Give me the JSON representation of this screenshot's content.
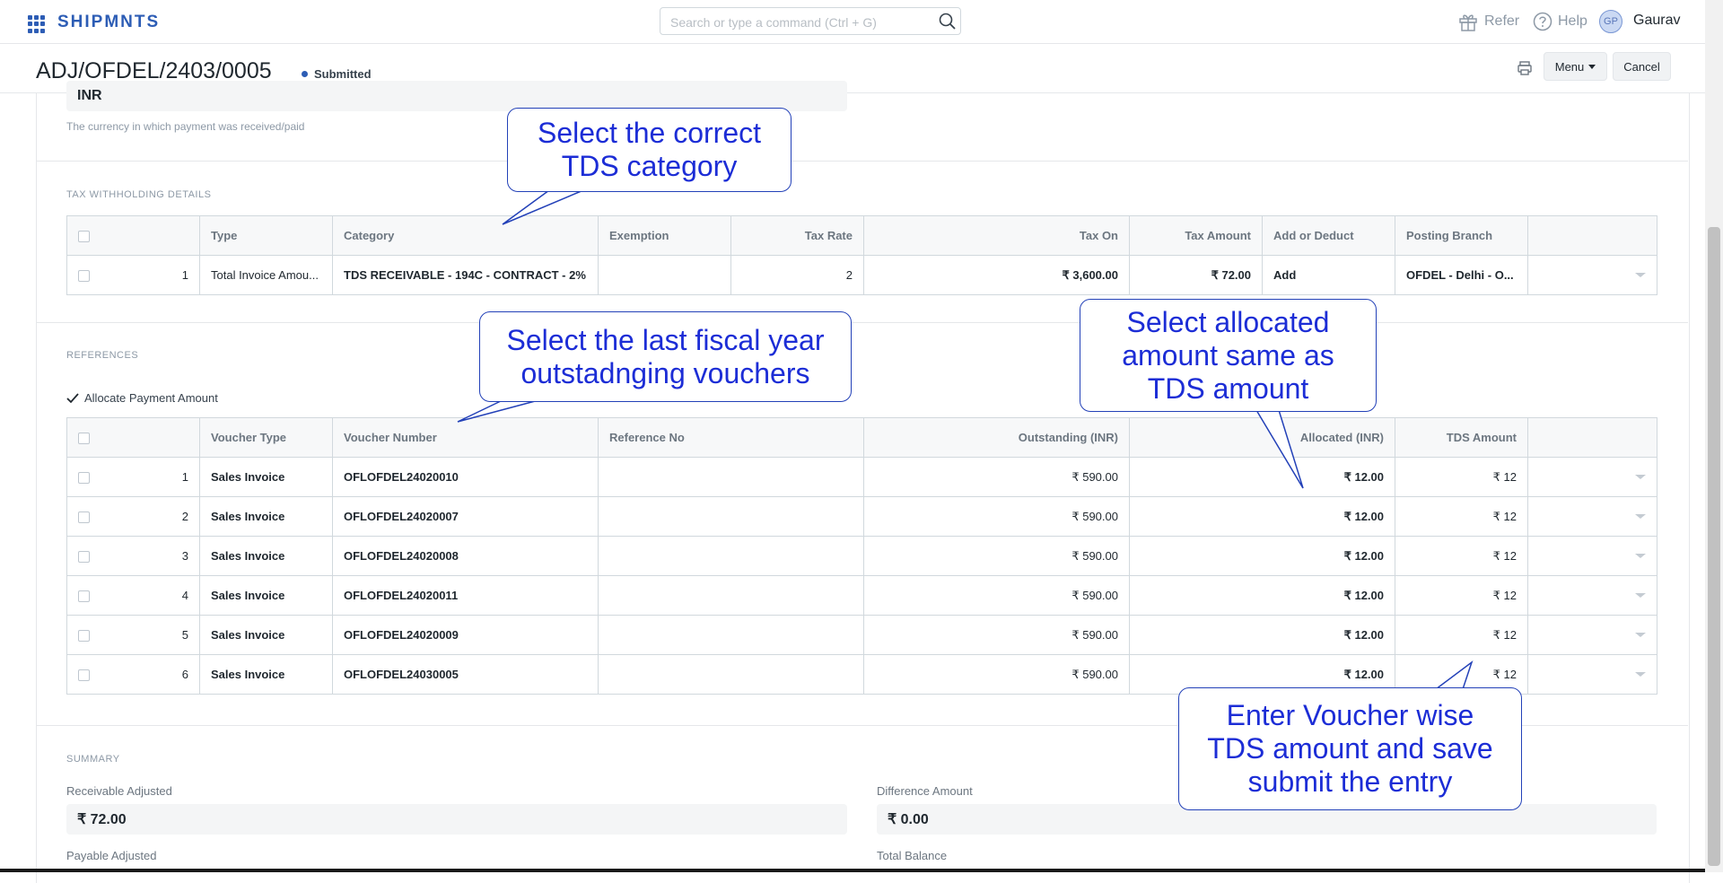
{
  "navbar": {
    "brand": "SHIPMNTS",
    "search_placeholder": "Search or type a command (Ctrl + G)",
    "refer": "Refer",
    "help": "Help",
    "avatar_initials": "GP",
    "username": "Gaurav"
  },
  "header": {
    "title": "ADJ/OFDEL/2403/0005",
    "status": "Submitted",
    "menu_label": "Menu",
    "cancel_label": "Cancel"
  },
  "currency": {
    "value": "INR",
    "help": "The currency in which payment was received/paid"
  },
  "tax_withholding": {
    "section_label": "TAX WITHHOLDING DETAILS",
    "columns": [
      "Type",
      "Category",
      "Exemption",
      "Tax Rate",
      "Tax On",
      "Tax Amount",
      "Add or Deduct",
      "Posting Branch"
    ],
    "rows": [
      {
        "idx": "1",
        "type": "Total Invoice Amou...",
        "category": "TDS RECEIVABLE - 194C - CONTRACT - 2%",
        "exemption": "",
        "tax_rate": "2",
        "tax_on": "₹ 3,600.00",
        "tax_amount": "₹ 72.00",
        "add_deduct": "Add",
        "posting_branch": "OFDEL - Delhi - O..."
      }
    ]
  },
  "references": {
    "section_label": "REFERENCES",
    "allocate_label": "Allocate Payment Amount",
    "columns": [
      "Voucher Type",
      "Voucher Number",
      "Reference No",
      "Outstanding (INR)",
      "Allocated (INR)",
      "TDS Amount"
    ],
    "rows": [
      {
        "idx": "1",
        "voucher_type": "Sales Invoice",
        "voucher_number": "OFLOFDEL24020010",
        "reference_no": "",
        "outstanding": "₹ 590.00",
        "allocated": "₹ 12.00",
        "tds": "₹ 12"
      },
      {
        "idx": "2",
        "voucher_type": "Sales Invoice",
        "voucher_number": "OFLOFDEL24020007",
        "reference_no": "",
        "outstanding": "₹ 590.00",
        "allocated": "₹ 12.00",
        "tds": "₹ 12"
      },
      {
        "idx": "3",
        "voucher_type": "Sales Invoice",
        "voucher_number": "OFLOFDEL24020008",
        "reference_no": "",
        "outstanding": "₹ 590.00",
        "allocated": "₹ 12.00",
        "tds": "₹ 12"
      },
      {
        "idx": "4",
        "voucher_type": "Sales Invoice",
        "voucher_number": "OFLOFDEL24020011",
        "reference_no": "",
        "outstanding": "₹ 590.00",
        "allocated": "₹ 12.00",
        "tds": "₹ 12"
      },
      {
        "idx": "5",
        "voucher_type": "Sales Invoice",
        "voucher_number": "OFLOFDEL24020009",
        "reference_no": "",
        "outstanding": "₹ 590.00",
        "allocated": "₹ 12.00",
        "tds": "₹ 12"
      },
      {
        "idx": "6",
        "voucher_type": "Sales Invoice",
        "voucher_number": "OFLOFDEL24030005",
        "reference_no": "",
        "outstanding": "₹ 590.00",
        "allocated": "₹ 12.00",
        "tds": "₹ 12"
      }
    ]
  },
  "summary": {
    "section_label": "SUMMARY",
    "receivable_label": "Receivable Adjusted",
    "receivable_value": "₹ 72.00",
    "difference_label": "Difference Amount",
    "difference_value": "₹ 0.00",
    "payable_label": "Payable Adjusted",
    "total_balance_label": "Total Balance"
  },
  "callouts": {
    "tds_category": [
      "Select the correct",
      "TDS category"
    ],
    "fiscal_year": [
      "Select the last fiscal year",
      "outstadnging vouchers"
    ],
    "allocated": [
      "Select allocated",
      "amount same as",
      "TDS amount"
    ],
    "voucher_tds": [
      "Enter Voucher wise",
      "TDS amount and save",
      "submit the entry"
    ]
  },
  "colors": {
    "brand": "#2d5db5",
    "callout_text": "#1c2dd6",
    "callout_border": "#2341b8"
  }
}
